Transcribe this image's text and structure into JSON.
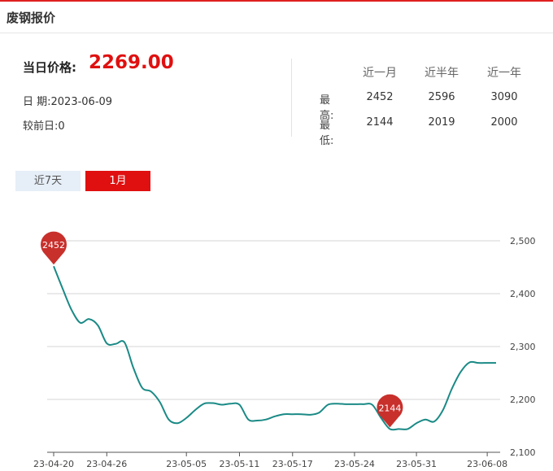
{
  "header": {
    "title": "废钢报价"
  },
  "price": {
    "label": "当日价格:",
    "value": "2269.00"
  },
  "info": {
    "date_label": "日 期:",
    "date": "2023-06-09",
    "change_label": "较前日:",
    "change": "0"
  },
  "stats": {
    "columns": [
      "近一月",
      "近半年",
      "近一年"
    ],
    "rows": [
      {
        "label": "最高:",
        "values": [
          "2452",
          "2596",
          "3090"
        ]
      },
      {
        "label": "最低:",
        "values": [
          "2144",
          "2019",
          "2000"
        ]
      }
    ]
  },
  "tabs": [
    {
      "label": "近7天",
      "active": false
    },
    {
      "label": "1月",
      "active": true
    }
  ],
  "colors": {
    "accent": "#e01010",
    "line": "#1a8a86",
    "marker": "#c8302c",
    "grid": "#d4d4d4"
  },
  "chart_data": {
    "type": "line",
    "x": [
      "23-04-20",
      "23-04-21",
      "23-04-22",
      "23-04-23",
      "23-04-24",
      "23-04-25",
      "23-04-26",
      "23-04-27",
      "23-04-28",
      "23-04-29",
      "23-04-30",
      "23-05-01",
      "23-05-02",
      "23-05-03",
      "23-05-04",
      "23-05-05",
      "23-05-06",
      "23-05-07",
      "23-05-08",
      "23-05-09",
      "23-05-10",
      "23-05-11",
      "23-05-12",
      "23-05-13",
      "23-05-14",
      "23-05-15",
      "23-05-16",
      "23-05-17",
      "23-05-18",
      "23-05-19",
      "23-05-20",
      "23-05-21",
      "23-05-22",
      "23-05-23",
      "23-05-24",
      "23-05-25",
      "23-05-26",
      "23-05-27",
      "23-05-28",
      "23-05-29",
      "23-05-30",
      "23-05-31",
      "23-06-01",
      "23-06-02",
      "23-06-03",
      "23-06-04",
      "23-06-05",
      "23-06-06",
      "23-06-07",
      "23-06-08",
      "23-06-09"
    ],
    "series": [
      {
        "values": [
          2452,
          2410,
          2370,
          2345,
          2352,
          2340,
          2306,
          2305,
          2308,
          2260,
          2222,
          2215,
          2195,
          2162,
          2155,
          2165,
          2180,
          2192,
          2193,
          2190,
          2192,
          2190,
          2162,
          2160,
          2162,
          2168,
          2172,
          2172,
          2172,
          2171,
          2175,
          2190,
          2192,
          2191,
          2191,
          2191,
          2190,
          2165,
          2144,
          2144,
          2144,
          2155,
          2162,
          2158,
          2180,
          2220,
          2252,
          2270,
          2269,
          2269,
          2269
        ]
      }
    ],
    "x_ticks": [
      "23-04-20",
      "23-04-26",
      "23-05-05",
      "23-05-11",
      "23-05-17",
      "23-05-24",
      "23-05-31",
      "23-06-08"
    ],
    "y_ticks": [
      "2,100",
      "2,200",
      "2,300",
      "2,400",
      "2,500"
    ],
    "ylim": [
      2100,
      2500
    ],
    "markers": [
      {
        "label": "2452",
        "value": 2452,
        "x": "23-04-20"
      },
      {
        "label": "2144",
        "value": 2144,
        "x": "23-05-28"
      }
    ],
    "grid": true
  }
}
